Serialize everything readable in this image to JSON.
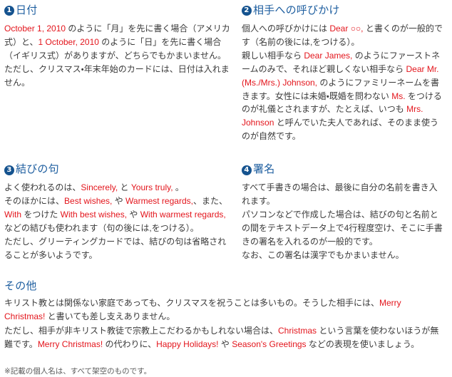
{
  "document": {
    "body_text_color": "#3a3a3a",
    "heading_color": "#1f5fa0",
    "badge_color": "#15538f",
    "english_accent_color": "#e3151c"
  },
  "sections": [
    {
      "number": "❶",
      "number_plain": "1",
      "title": "日付",
      "paragraphs": [
        {
          "runs": [
            {
              "t": "October 1, 2010",
              "en": true
            },
            {
              "t": " のように「月」を先に書く場合（アメリカ式）と、",
              "en": false
            },
            {
              "t": "1 October, 2010",
              "en": true
            },
            {
              "t": " のように「日」を先に書く場合（イギリス式）がありますが、どちらでもかまいません。",
              "en": false
            }
          ]
        },
        {
          "runs": [
            {
              "t": "ただし、クリスマス・年末年始のカードには、日付は入れません。",
              "en": false
            }
          ]
        }
      ]
    },
    {
      "number": "❷",
      "number_plain": "2",
      "title": "相手への呼びかけ",
      "paragraphs": [
        {
          "runs": [
            {
              "t": "個人への呼びかけには ",
              "en": false
            },
            {
              "t": "Dear ○○,",
              "en": true
            },
            {
              "t": " と書くのが一般的です（名前の後には,をつける）。",
              "en": false
            }
          ]
        },
        {
          "runs": [
            {
              "t": "親しい相手なら ",
              "en": false
            },
            {
              "t": "Dear James,",
              "en": true
            },
            {
              "t": " のようにファーストネームのみで、それほど親しくない相手なら ",
              "en": false
            },
            {
              "t": "Dear Mr.(Ms./Mrs.) Johnson,",
              "en": true
            },
            {
              "t": " のようにファミリーネームを書きます。女性には未婚・既婚を問わない ",
              "en": false
            },
            {
              "t": "Ms.",
              "en": true
            },
            {
              "t": " をつけるのが礼儀とされますが、たとえば、いつも ",
              "en": false
            },
            {
              "t": "Mrs. Johnson",
              "en": true
            },
            {
              "t": " と呼んでいた夫人であれば、そのまま使うのが自然です。",
              "en": false
            }
          ]
        }
      ]
    },
    {
      "number": "❸",
      "number_plain": "3",
      "title": "結びの句",
      "paragraphs": [
        {
          "runs": [
            {
              "t": "よく使われるのは、",
              "en": false
            },
            {
              "t": "Sincerely,",
              "en": true
            },
            {
              "t": " と ",
              "en": false
            },
            {
              "t": "Yours truly,",
              "en": true
            },
            {
              "t": " 。",
              "en": false
            }
          ]
        },
        {
          "runs": [
            {
              "t": "そのほかには、",
              "en": false
            },
            {
              "t": "Best wishes,",
              "en": true
            },
            {
              "t": " や ",
              "en": false
            },
            {
              "t": "Warmest regards,",
              "en": true
            },
            {
              "t": "、また、 ",
              "en": false
            },
            {
              "t": "With",
              "en": true
            },
            {
              "t": " をつけた ",
              "en": false
            },
            {
              "t": "With best wishes,",
              "en": true
            },
            {
              "t": " や ",
              "en": false
            },
            {
              "t": "With warmest regards,",
              "en": true
            },
            {
              "t": " などの結びも使われます（句の後には,をつける）。",
              "en": false
            }
          ]
        },
        {
          "runs": [
            {
              "t": "ただし、グリーティングカードでは、結びの句は省略されることが多いようです。",
              "en": false
            }
          ]
        }
      ]
    },
    {
      "number": "❹",
      "number_plain": "4",
      "title": "署名",
      "paragraphs": [
        {
          "runs": [
            {
              "t": "すべて手書きの場合は、最後に自分の名前を書き入れます。",
              "en": false
            }
          ]
        },
        {
          "runs": [
            {
              "t": "パソコンなどで作成した場合は、結びの句と名前との間をテキストデータ上で4行程度空け、そこに手書きの署名を入れるのが一般的です。",
              "en": false
            }
          ]
        },
        {
          "runs": [
            {
              "t": "なお、この署名は漢字でもかまいません。",
              "en": false
            }
          ]
        }
      ]
    }
  ],
  "other": {
    "title": "その他",
    "paragraphs": [
      {
        "runs": [
          {
            "t": "キリスト教とは関係ない家庭であっても、クリスマスを祝うことは多いもの。そうした相手には、",
            "en": false
          },
          {
            "t": "Merry Christmas!",
            "en": true
          },
          {
            "t": " と書いても差し支えありません。",
            "en": false
          }
        ]
      },
      {
        "runs": [
          {
            "t": "ただし、相手が非キリスト教徒で宗教上こだわるかもしれない場合は、",
            "en": false
          },
          {
            "t": "Christmas",
            "en": true
          },
          {
            "t": " という言葉を使わないほうが無難です。",
            "en": false
          },
          {
            "t": "Merry Christmas!",
            "en": true
          },
          {
            "t": " の代わりに、",
            "en": false
          },
          {
            "t": "Happy Holidays!",
            "en": true
          },
          {
            "t": " や ",
            "en": false
          },
          {
            "t": "Season's Greetings",
            "en": true
          },
          {
            "t": " などの表現を使いましょう。",
            "en": false
          }
        ]
      }
    ]
  },
  "footnote": {
    "text": "※記載の個人名は、すべて架空のものです。"
  }
}
